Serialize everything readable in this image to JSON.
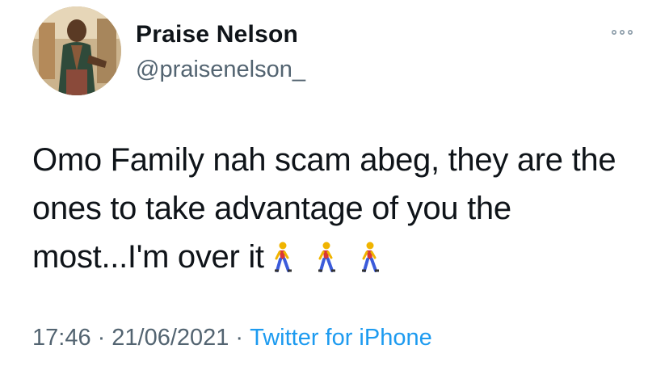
{
  "user": {
    "display_name": "Praise Nelson",
    "handle": "@praisenelson_",
    "avatar_icon": "profile-photo"
  },
  "tweet": {
    "text": "Omo Family nah scam abeg, they are the ones to take advantage of you the most...I'm over it",
    "emojis": [
      "person-walking-icon",
      "person-walking-icon",
      "person-walking-icon"
    ]
  },
  "meta": {
    "time": "17:46",
    "separator": "·",
    "date": "21/06/2021",
    "source": "Twitter for iPhone"
  },
  "menu": {
    "icon": "more-options-icon"
  },
  "colors": {
    "text": "#0f1419",
    "secondary": "#536471",
    "link": "#1d9bf0"
  }
}
